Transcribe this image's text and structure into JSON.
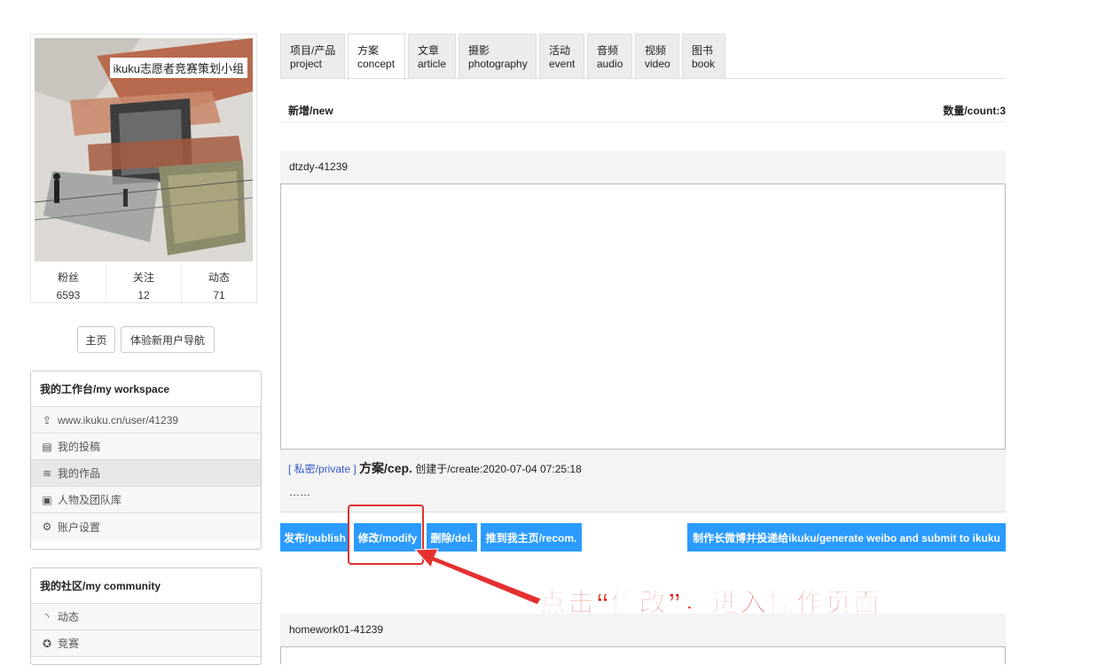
{
  "profile": {
    "cover_title": "ikuku志愿者竞赛策划小组",
    "stats": [
      {
        "label": "粉丝",
        "value": "6593"
      },
      {
        "label": "关注",
        "value": "12"
      },
      {
        "label": "动态",
        "value": "71"
      }
    ],
    "home_button": "主页",
    "guide_button": "体验新用户导航"
  },
  "workspace": {
    "title": "我的工作台/my workspace",
    "items": [
      {
        "icon": "share-icon",
        "glyph": "⇪",
        "label": "www.ikuku.cn/user/41239"
      },
      {
        "icon": "clipboard-icon",
        "glyph": "▤",
        "label": "我的投稿"
      },
      {
        "icon": "layers-icon",
        "glyph": "≋",
        "label": "我的作品"
      },
      {
        "icon": "id-card-icon",
        "glyph": "▣",
        "label": "人物及团队库"
      },
      {
        "icon": "gear-icon",
        "glyph": "⚙",
        "label": "账户设置"
      }
    ]
  },
  "community": {
    "title": "我的社区/my community",
    "items": [
      {
        "icon": "rss-icon",
        "glyph": "◝",
        "label": "动态"
      },
      {
        "icon": "award-icon",
        "glyph": "✪",
        "label": "竞赛"
      }
    ]
  },
  "tabs": [
    {
      "line1": "项目/产品",
      "line2": "project"
    },
    {
      "line1": "方案",
      "line2": "concept"
    },
    {
      "line1": "文章",
      "line2": "article"
    },
    {
      "line1": "摄影",
      "line2": "photography"
    },
    {
      "line1": "活动",
      "line2": "event"
    },
    {
      "line1": "音频",
      "line2": "audio"
    },
    {
      "line1": "视频",
      "line2": "video"
    },
    {
      "line1": "图书",
      "line2": "book"
    }
  ],
  "list": {
    "new_label": "新增/new",
    "count_label": "数量/count:3"
  },
  "item1": {
    "name": "dtzdy-41239",
    "privacy": "[ 私密/private ]",
    "type": "方案/cep.",
    "created": "创建于/create:2020-07-04 07:25:18",
    "excerpt": "……",
    "actions": {
      "publish": "发布/publish",
      "modify": "修改/modify",
      "delete": "删除/del.",
      "recommend": "推到我主页/recom.",
      "weibo": "制作长微博并投递给ikuku/generate weibo and submit to ikuku"
    }
  },
  "annotation": "点击“修改”，进入操作页面",
  "item2": {
    "name": "homework01-41239"
  },
  "colors": {
    "action_blue": "#2b9bff",
    "annotation_red": "#e02020"
  }
}
